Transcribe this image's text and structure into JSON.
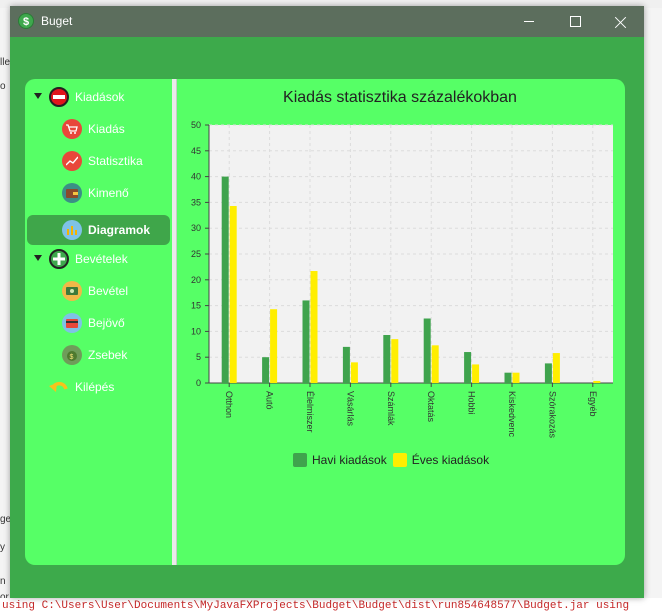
{
  "window": {
    "title": "Buget",
    "icon": "dollar-coin-icon"
  },
  "background": {
    "console_line": "using C:\\Users\\User\\Documents\\MyJavaFXProjects\\Budget\\Budget\\dist\\run854648577\\Budget.jar using",
    "left_fragments": [
      "lle",
      "o",
      "ge",
      "y",
      "n",
      "or"
    ]
  },
  "sidebar": {
    "expenses_group": {
      "label": "Kiadások",
      "icon": "minus-circle-icon"
    },
    "expenses_items": [
      {
        "label": "Kiadás",
        "icon": "cart-icon"
      },
      {
        "label": "Statisztika",
        "icon": "stats-icon"
      },
      {
        "label": "Kimenő",
        "icon": "wallet-icon"
      },
      {
        "label": "Diagramok",
        "icon": "bar-chart-icon",
        "selected": true
      }
    ],
    "income_group": {
      "label": "Bevételek",
      "icon": "plus-circle-icon"
    },
    "income_items": [
      {
        "label": "Bevétel",
        "icon": "money-icon"
      },
      {
        "label": "Bejövő",
        "icon": "card-icon"
      },
      {
        "label": "Zsebek",
        "icon": "money-bag-icon"
      }
    ],
    "exit": {
      "label": "Kilépés",
      "icon": "undo-arrow-icon"
    }
  },
  "colors": {
    "window_bg": "#3daa4b",
    "panel_bg": "#56ff66",
    "series_monthly": "#3fa34d",
    "series_yearly": "#ffee00"
  },
  "chart_data": {
    "type": "bar",
    "title": "Kiadás statisztika százalékokban",
    "categories": [
      "Otthon",
      "Autó",
      "Élelmiszer",
      "Vásárlás",
      "Számlák",
      "Oktatás",
      "Hobbi",
      "Kiskedvenc",
      "Szórakozás",
      "Egyéb"
    ],
    "series": [
      {
        "name": "Havi kiadások",
        "values": [
          40,
          5,
          16,
          7,
          9.3,
          12.5,
          6,
          2,
          3.8,
          0
        ]
      },
      {
        "name": "Éves kiadások",
        "values": [
          34.3,
          14.3,
          21.7,
          4,
          8.5,
          7.3,
          3.6,
          2,
          5.8,
          0.4
        ]
      }
    ],
    "ylim": [
      0,
      50
    ],
    "yticks": [
      0,
      5,
      10,
      15,
      20,
      25,
      30,
      35,
      40,
      45,
      50
    ],
    "grid": true,
    "legend": "bottom"
  }
}
